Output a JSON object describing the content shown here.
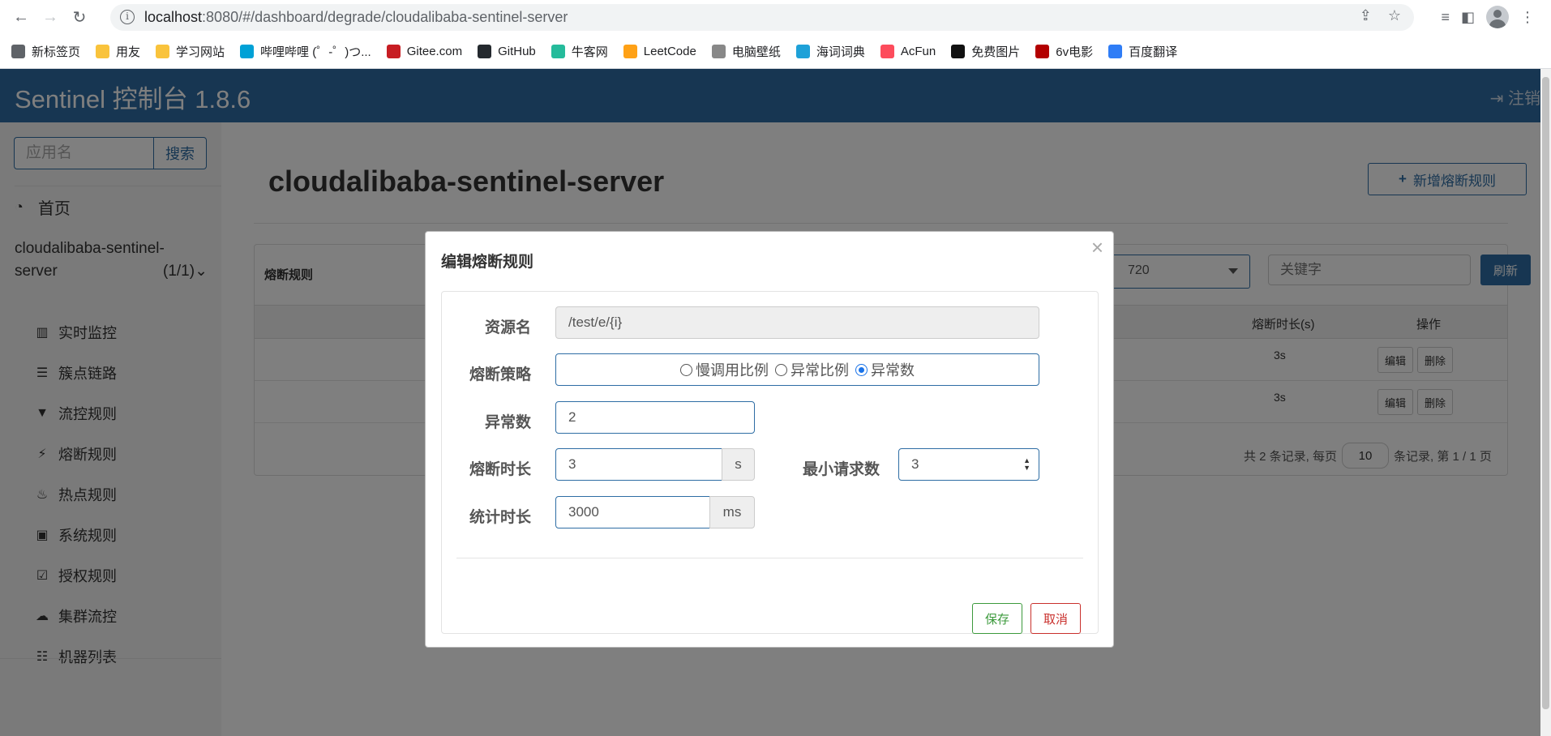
{
  "browser": {
    "url_host": "localhost",
    "url_path": ":8080/#/dashboard/degrade/cloudalibaba-sentinel-server",
    "bookmarks": [
      {
        "label": "新标签页",
        "color": "#5f6368"
      },
      {
        "label": "用友",
        "color": "#f9c33c"
      },
      {
        "label": "学习网站",
        "color": "#f9c33c"
      },
      {
        "label": "哔哩哔哩 (゜-゜)つ...",
        "color": "#00a1d6"
      },
      {
        "label": "Gitee.com",
        "color": "#c71d23"
      },
      {
        "label": "GitHub",
        "color": "#24292e"
      },
      {
        "label": "牛客网",
        "color": "#25bb9b"
      },
      {
        "label": "LeetCode",
        "color": "#ffa116"
      },
      {
        "label": "电脑壁纸",
        "color": "#888888"
      },
      {
        "label": "海词词典",
        "color": "#1ea1d8"
      },
      {
        "label": "AcFun",
        "color": "#fd4c5c"
      },
      {
        "label": "免费图片",
        "color": "#111111"
      },
      {
        "label": "6v电影",
        "color": "#b30000"
      },
      {
        "label": "百度翻译",
        "color": "#2f7df6"
      }
    ]
  },
  "app": {
    "brand": "Sentinel 控制台 1.8.6",
    "logout": "注销",
    "sidebar": {
      "search_placeholder": "应用名",
      "search_button": "搜索",
      "home": "首页",
      "app_name_line1": "cloudalibaba-sentinel-",
      "app_name_line2": "server",
      "app_count": "(1/1)",
      "items": [
        {
          "label": "实时监控",
          "icon": "▥"
        },
        {
          "label": "簇点链路",
          "icon": "☰"
        },
        {
          "label": "流控规则",
          "icon": "▼"
        },
        {
          "label": "熔断规则",
          "icon": "⚡"
        },
        {
          "label": "热点规则",
          "icon": "♨"
        },
        {
          "label": "系统规则",
          "icon": "▣"
        },
        {
          "label": "授权规则",
          "icon": "☑"
        },
        {
          "label": "集群流控",
          "icon": "☁"
        },
        {
          "label": "机器列表",
          "icon": "☷"
        }
      ]
    },
    "page_title": "cloudalibaba-sentinel-server",
    "add_button": "新增熔断规则",
    "panel": {
      "title": "熔断规则",
      "machine_value": "720",
      "keyword_placeholder": "关键字",
      "refresh": "刷新",
      "columns": {
        "duration": "熔断时长(s)",
        "ops": "操作"
      },
      "rows": [
        {
          "duration": "3s",
          "edit": "编辑",
          "delete": "删除"
        },
        {
          "duration": "3s",
          "edit": "编辑",
          "delete": "删除"
        }
      ],
      "pager": {
        "prefix": "共 2 条记录, 每页",
        "page_size": "10",
        "suffix": "条记录, 第 1 / 1 页"
      }
    }
  },
  "modal": {
    "title": "编辑熔断规则",
    "close": "×",
    "resource_label": "资源名",
    "resource_value": "/test/e/{i}",
    "strategy_label": "熔断策略",
    "strategy_options": [
      "慢调用比例",
      "异常比例",
      "异常数"
    ],
    "strategy_selected": "异常数",
    "exception_count_label": "异常数",
    "exception_count_value": "2",
    "break_duration_label": "熔断时长",
    "break_duration_value": "3",
    "break_duration_unit": "s",
    "min_request_label": "最小请求数",
    "min_request_value": "3",
    "stat_duration_label": "统计时长",
    "stat_duration_value": "3000",
    "stat_duration_unit": "ms",
    "save": "保存",
    "cancel": "取消"
  }
}
